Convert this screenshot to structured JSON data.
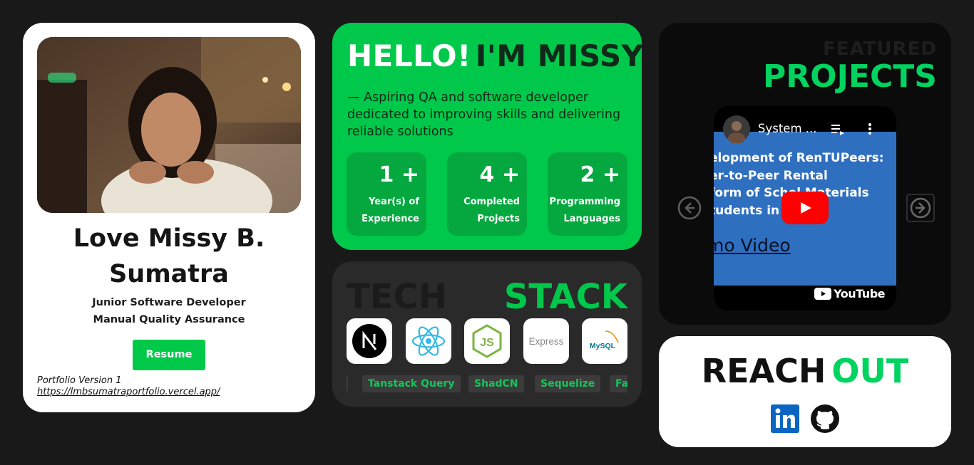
{
  "profile": {
    "name_line1": "Love Missy B.",
    "name_line2": "Sumatra",
    "role_line1": "Junior Software Developer",
    "role_line2": "Manual Quality Assurance",
    "resume_label": "Resume",
    "portfolio_version": "Portfolio Version 1",
    "portfolio_link": "https://lmbsumatraportfolio.vercel.app/"
  },
  "hello": {
    "title_white": "HELLO!",
    "title_dark": "I'M MISSY",
    "description": "— Aspiring QA and software developer dedicated to improving skills and delivering reliable solutions",
    "stats": [
      {
        "number": "1 +",
        "label_line1": "Year(s) of",
        "label_line2": "Experience"
      },
      {
        "number": "4 +",
        "label_line1": "Completed",
        "label_line2": "Projects"
      },
      {
        "number": "2 +",
        "label_line1": "Programming",
        "label_line2": "Languages"
      }
    ]
  },
  "tech": {
    "title_dim": "TECH",
    "title_accent": "STACK",
    "icons": [
      "nextjs-icon",
      "react-icon",
      "nodejs-icon",
      "express-icon",
      "mysql-icon"
    ],
    "express_text": "Express",
    "mysql_text": "MySQL",
    "nodejs_text": "JS",
    "tags": [
      "Tanstack Query",
      "ShadCN",
      "Sequelize",
      "Fa"
    ]
  },
  "featured": {
    "title_dim": "FEATURED",
    "title_accent": "PROJECTS",
    "video_title": "System ...",
    "video_text_line1": "elopment of RenTUPeers:",
    "video_text_line2": "er-to-Peer Rental",
    "video_text_line3": "form of Schol Materials",
    "video_text_line4": "tudents in T   nila",
    "video_demo": "mo Video",
    "youtube_label": "YouTube"
  },
  "reach": {
    "title_dark": "REACH",
    "title_accent": "OUT",
    "links": [
      "linkedin-icon",
      "github-icon"
    ]
  },
  "colors": {
    "accent_green": "#00c84a",
    "background": "#191919"
  }
}
